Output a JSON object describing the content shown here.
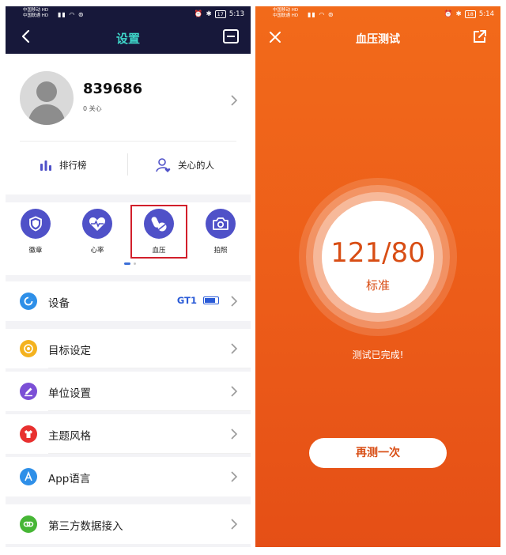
{
  "left_status": {
    "carrier_1": "中国移动 HD",
    "carrier_2": "中国联通 HD",
    "battery": "17",
    "time": "5:13"
  },
  "right_status": {
    "carrier_1": "中国移动 HD",
    "carrier_2": "中国联通 HD",
    "battery": "18",
    "time": "5:14"
  },
  "settings": {
    "title": "设置",
    "profile": {
      "username": "839686",
      "follow_text": "0 关心"
    },
    "quick_links": [
      {
        "label": "排行榜",
        "icon": "bar-chart-icon"
      },
      {
        "label": "关心的人",
        "icon": "person-heart-icon"
      }
    ],
    "features": [
      {
        "label": "徽章",
        "icon": "shield-icon"
      },
      {
        "label": "心率",
        "icon": "heart-rate-icon"
      },
      {
        "label": "血压",
        "icon": "pill-icon"
      },
      {
        "label": "拍照",
        "icon": "camera-icon"
      }
    ],
    "device": {
      "label": "设备",
      "value": "GT1"
    },
    "menu": [
      {
        "label": "目标设定",
        "icon": "target-icon",
        "color": "#f4b21f"
      },
      {
        "label": "单位设置",
        "icon": "pencil-icon",
        "color": "#7b4fd6"
      },
      {
        "label": "主题风格",
        "icon": "shirt-icon",
        "color": "#e8302f"
      },
      {
        "label": "App语言",
        "icon": "letter-a-icon",
        "color": "#2e8fe8"
      }
    ],
    "third_party": {
      "label": "第三方数据接入",
      "icon": "link-icon",
      "color": "#46b635"
    }
  },
  "bp_test": {
    "title": "血压测试",
    "reading": "121/80",
    "status": "标准",
    "message": "测试已完成!",
    "retest_label": "再测一次",
    "colors": {
      "background": "#ec5c19",
      "reading": "#d84d14"
    }
  }
}
